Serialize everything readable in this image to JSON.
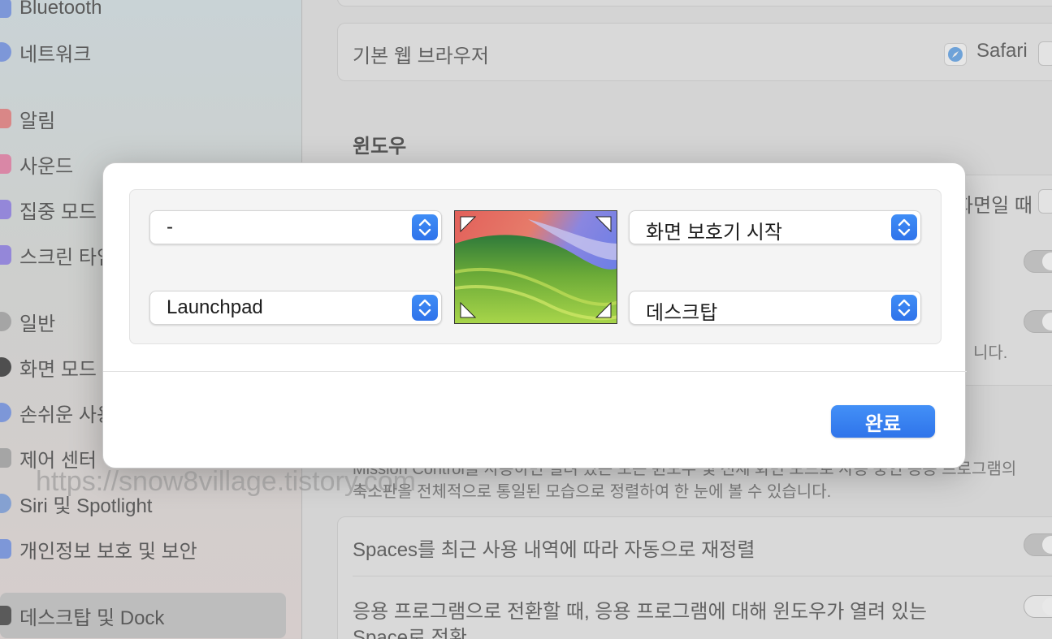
{
  "sidebar": {
    "items": [
      {
        "label": "Bluetooth",
        "icon": "bluetooth-icon",
        "color": "#6f8ed9"
      },
      {
        "label": "네트워크",
        "icon": "globe-icon",
        "color": "#6f8ed9"
      },
      {
        "label": "알림",
        "icon": "bell-icon",
        "color": "#d97b7b"
      },
      {
        "label": "사운드",
        "icon": "speaker-icon",
        "color": "#d97b9e"
      },
      {
        "label": "집중 모드",
        "icon": "moon-icon",
        "color": "#8a7bd9"
      },
      {
        "label": "스크린 타임",
        "icon": "hourglass-icon",
        "color": "#8a7bd9"
      },
      {
        "label": "일반",
        "icon": "gear-icon",
        "color": "#9a9a9a"
      },
      {
        "label": "화면 모드",
        "icon": "appearance-icon",
        "color": "#4a4a4a"
      },
      {
        "label": "손쉬운 사용",
        "icon": "accessibility-icon",
        "color": "#6f8ed9"
      },
      {
        "label": "제어 센터",
        "icon": "control-center-icon",
        "color": "#9a9a9a"
      },
      {
        "label": "Siri 및 Spotlight",
        "icon": "siri-icon",
        "color": "#7a9ad0"
      },
      {
        "label": "개인정보 보호 및 보안",
        "icon": "hand-icon",
        "color": "#6f8ed9"
      },
      {
        "label": "데스크탑 및 Dock",
        "icon": "dock-icon",
        "color": "#555555"
      }
    ]
  },
  "main": {
    "default_browser_label": "기본 웹 브라우저",
    "default_browser_value": "Safari",
    "windows_section_title": "윈도우",
    "partial_row_value": "화면일 때",
    "partial_desc_1": "니다.",
    "mission_control_desc_1": "Mission Control을 사용하면 열려 있는 모든 윈도우 및 전체 화면 모드로 사용 중인 응용 프로그램의",
    "mission_control_desc_2": "축소판을 전체적으로 통일된 모습으로 정렬하여 한 눈에 볼 수 있습니다.",
    "spaces_rearrange_label": "Spaces를 최근 사용 내역에 따라 자동으로 재정렬",
    "switch_space_label_1": "응용 프로그램으로 전환할 때, 응용 프로그램에 대해 윈도우가 열려 있는",
    "switch_space_label_2": "Space로 전환"
  },
  "hot_corners": {
    "top_left": "-",
    "bottom_left": "Launchpad",
    "top_right": "화면 보호기 시작",
    "bottom_right": "데스크탑",
    "done_label": "완료"
  },
  "watermark": "https://snow8village.tistory.com",
  "colors": {
    "accent": "#3482f0"
  }
}
